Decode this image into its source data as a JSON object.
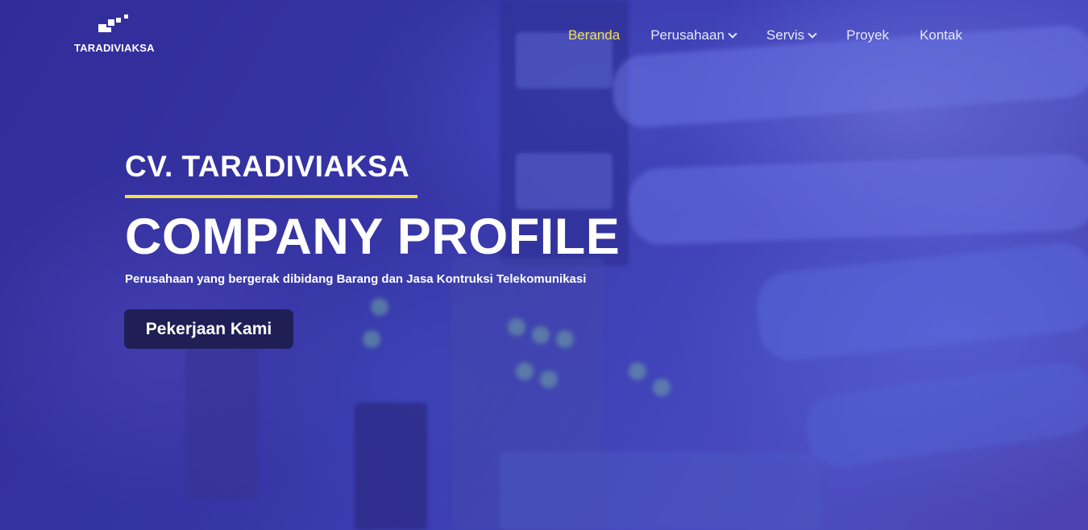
{
  "header": {
    "logo_text": "TARADIVIAKSA",
    "nav": [
      {
        "label": "Beranda",
        "active": true,
        "has_dropdown": false
      },
      {
        "label": "Perusahaan",
        "active": false,
        "has_dropdown": true
      },
      {
        "label": "Servis",
        "active": false,
        "has_dropdown": true
      },
      {
        "label": "Proyek",
        "active": false,
        "has_dropdown": false
      },
      {
        "label": "Kontak",
        "active": false,
        "has_dropdown": false
      }
    ]
  },
  "hero": {
    "company_name": "CV. TARADIVIAKSA",
    "headline": "COMPANY PROFILE",
    "tagline": "Perusahaan yang bergerak dibidang Barang dan Jasa Kontruksi Telekomunikasi",
    "cta_label": "Pekerjaan Kami"
  },
  "icons": {
    "logo_mark": "pixel-squares-icon",
    "dropdown": "chevron-down-icon"
  },
  "colors": {
    "accent_yellow": "#f3df4d",
    "button_bg": "#1f1f55",
    "text_white": "#ffffff",
    "overlay_purple": "#3a3a9a"
  }
}
